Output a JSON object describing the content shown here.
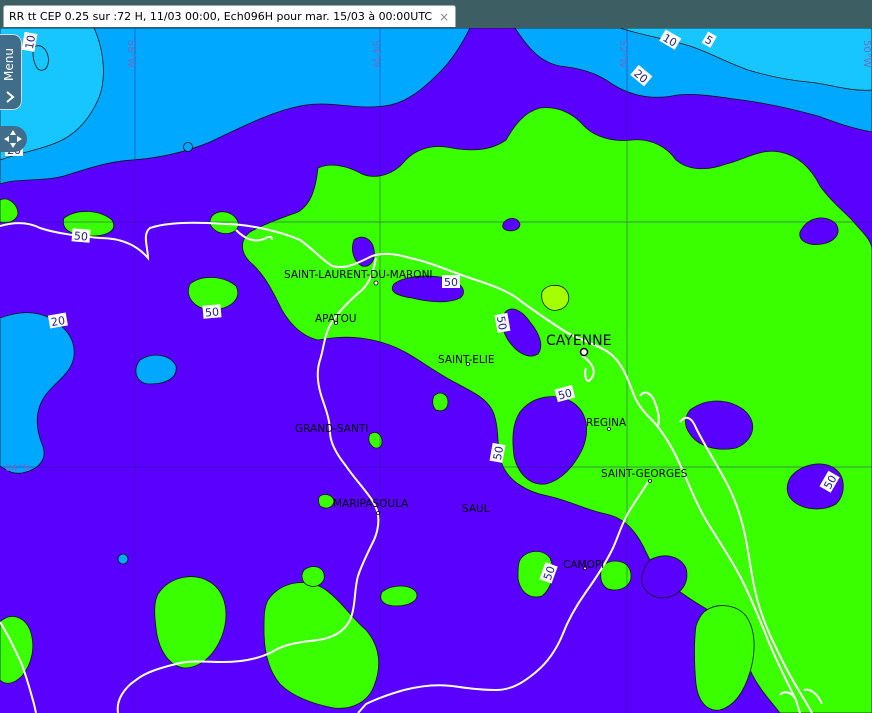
{
  "tab": {
    "title": "RR tt CEP 0.25 sur :72 H, 11/03 00:00, Ech096H pour mar. 15/03 à 00:00UTC",
    "close": "×"
  },
  "menu": {
    "label": "Menu"
  },
  "colors": {
    "band_0_20": "#5a00ff",
    "band_5_10": "#18c6ff",
    "band_10_20": "#00a8ff",
    "band_20_50": "#4a11ff",
    "band_50_100": "#39ff00",
    "band_100_plus": "#a6ff00",
    "coastline": "#ffffff",
    "contour": "#141414"
  },
  "graticule": {
    "lon_56": "56°W",
    "lon_54": "54°W",
    "lon_52": "52°W",
    "lon_50": "50°W",
    "lat_4": "04°N"
  },
  "cities": {
    "saint_laurent": "SAINT-LAURENT-DU-MARONI",
    "apatou": "APATOU",
    "saint_elie": "SAINT-ELIE",
    "cayenne": "CAYENNE",
    "regina": "REGINA",
    "grand_santi": "GRAND-SANTI",
    "saint_georges": "SAINT-GEORGES",
    "maripasoula": "MARIPASOULA",
    "saul": "SAUL",
    "camopi": "CAMOPI"
  },
  "contour_labels": {
    "l5": "5",
    "l10": "10",
    "l20": "20",
    "l50": "50"
  }
}
